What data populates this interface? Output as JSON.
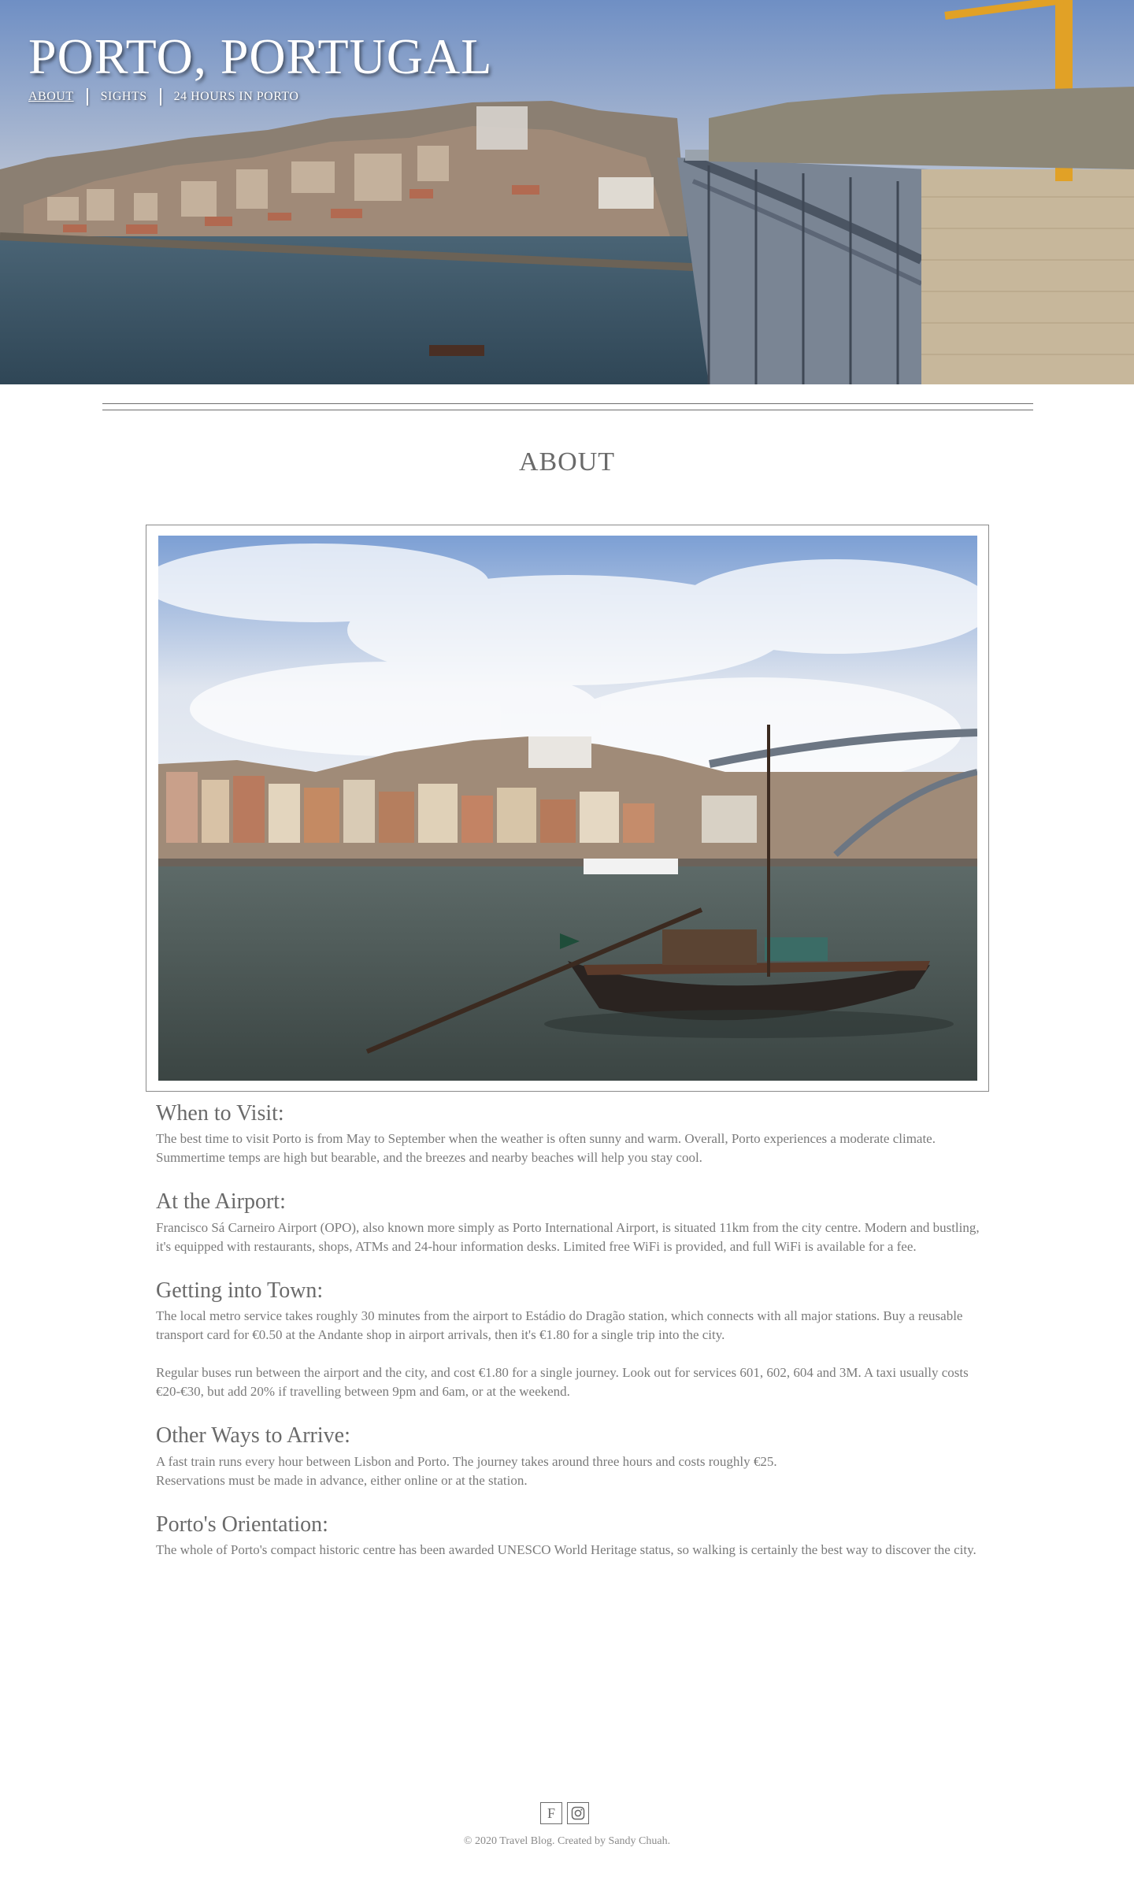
{
  "header": {
    "title": "PORTO, PORTUGAL",
    "nav": [
      {
        "label": "ABOUT",
        "active": true
      },
      {
        "label": "SIGHTS",
        "active": false
      },
      {
        "label": "24 HOURS IN PORTO",
        "active": false
      }
    ]
  },
  "main": {
    "section_title": "ABOUT",
    "sections": [
      {
        "heading": "When to Visit:",
        "paragraphs": [
          "The best time to visit Porto is from May to September when the weather is often sunny and warm. Overall, Porto experiences a moderate climate. Summertime temps are high but bearable, and the breezes and nearby beaches will help you stay cool."
        ]
      },
      {
        "heading": "At the Airport:",
        "paragraphs": [
          "Francisco Sá Carneiro Airport (OPO), also known more simply as Porto International Airport, is situated 11km from the city centre. Modern and bustling, it's equipped with restaurants, shops, ATMs and 24-hour information desks. Limited free WiFi is provided, and full WiFi is available for a fee."
        ]
      },
      {
        "heading": "Getting into Town:",
        "paragraphs": [
          "The local metro service takes roughly 30 minutes from the airport to Estádio do Dragão station, which connects with all major stations. Buy a reusable transport card for €0.50 at the Andante shop in airport arrivals, then it's €1.80 for a single trip into the city.",
          "Regular buses run between the airport and the city, and cost €1.80 for a single journey. Look out for services 601, 602, 604 and 3M. A taxi usually costs €20-€30, but add 20% if travelling between 9pm and 6am, or at the weekend."
        ]
      },
      {
        "heading": "Other Ways to Arrive:",
        "paragraphs": [
          "A fast train runs every hour between Lisbon and Porto. The journey takes around three hours and costs roughly €25. Reservations must be made in advance, either online or at the station."
        ]
      },
      {
        "heading": "Porto's Orientation:",
        "paragraphs": [
          "The whole of Porto's compact historic centre has been awarded UNESCO World Heritage status, so walking is certainly the best way to discover the city."
        ]
      }
    ]
  },
  "footer": {
    "icons": [
      "facebook-icon",
      "instagram-icon"
    ],
    "facebook_glyph": "F",
    "copyright": "© 2020 Travel Blog. Created by Sandy Chuah."
  },
  "colors": {
    "text": "#6a6a6a",
    "accent_white": "#ffffff"
  }
}
